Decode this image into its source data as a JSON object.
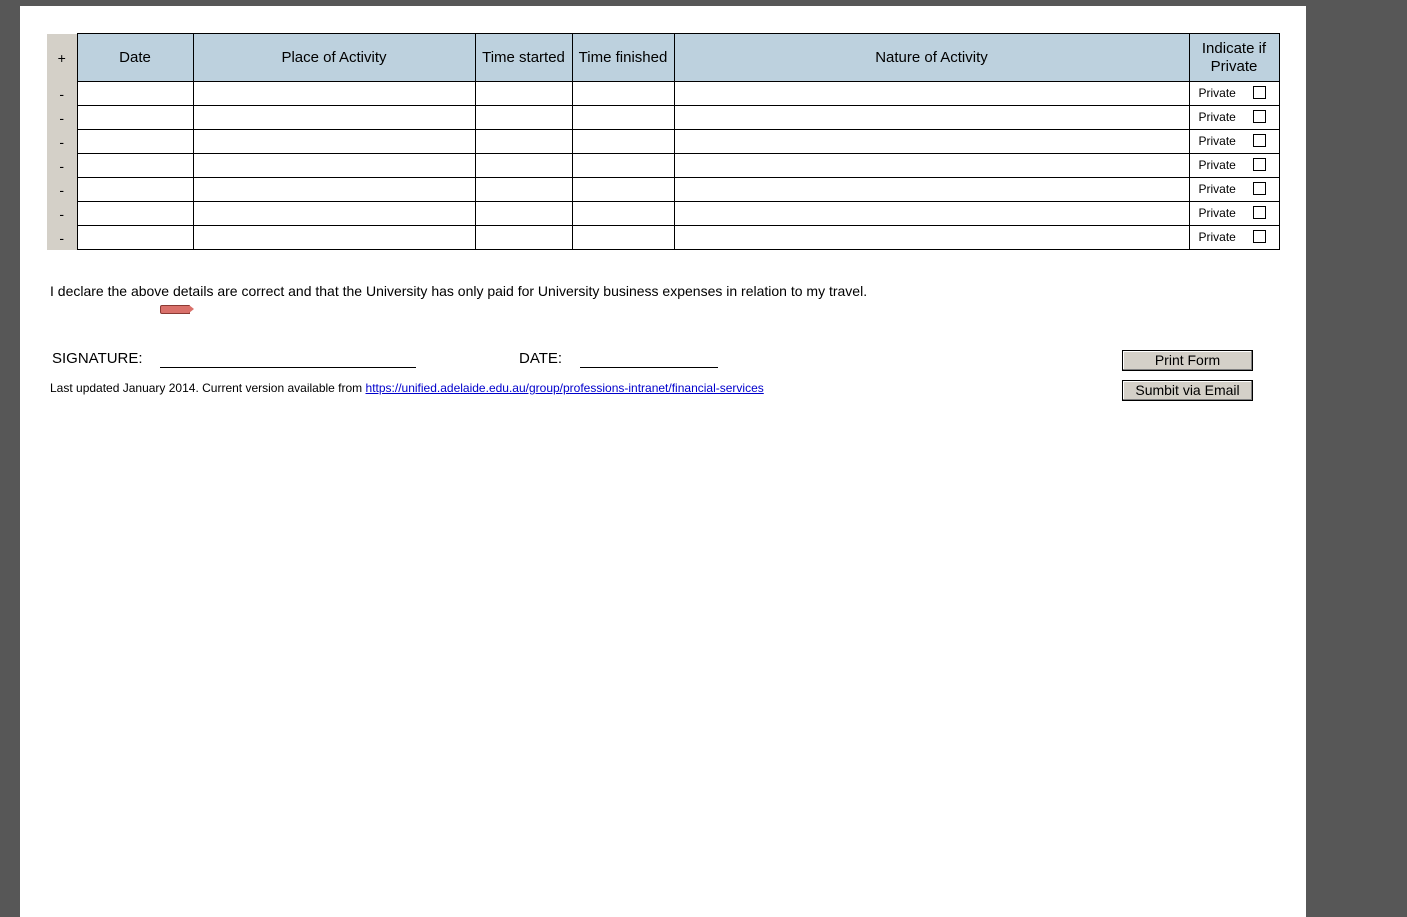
{
  "table": {
    "add_row_label": "+",
    "remove_row_label": "-",
    "columns": [
      "Date",
      "Place of Activity",
      "Time started",
      "Time finished",
      "Nature of Activity",
      "Indicate if Private"
    ],
    "private_label": "Private",
    "row_count": 7
  },
  "declaration": "I declare the above details are correct and that the University has only paid for University business expenses in relation to my travel.",
  "signature_label": "SIGNATURE:",
  "date_label": "DATE:",
  "footer": {
    "note": "Last updated January 2014. Current version available from ",
    "link_text": "https://unified.adelaide.edu.au/group/professions-intranet/financial-services"
  },
  "buttons": {
    "print_label": "Print Form",
    "email_label": "Sumbit via Email"
  },
  "colors": {
    "header_bg": "#bdd1de",
    "control_bg": "#d4d0c8",
    "viewer_bg": "#575757",
    "link": "#0000cc"
  }
}
